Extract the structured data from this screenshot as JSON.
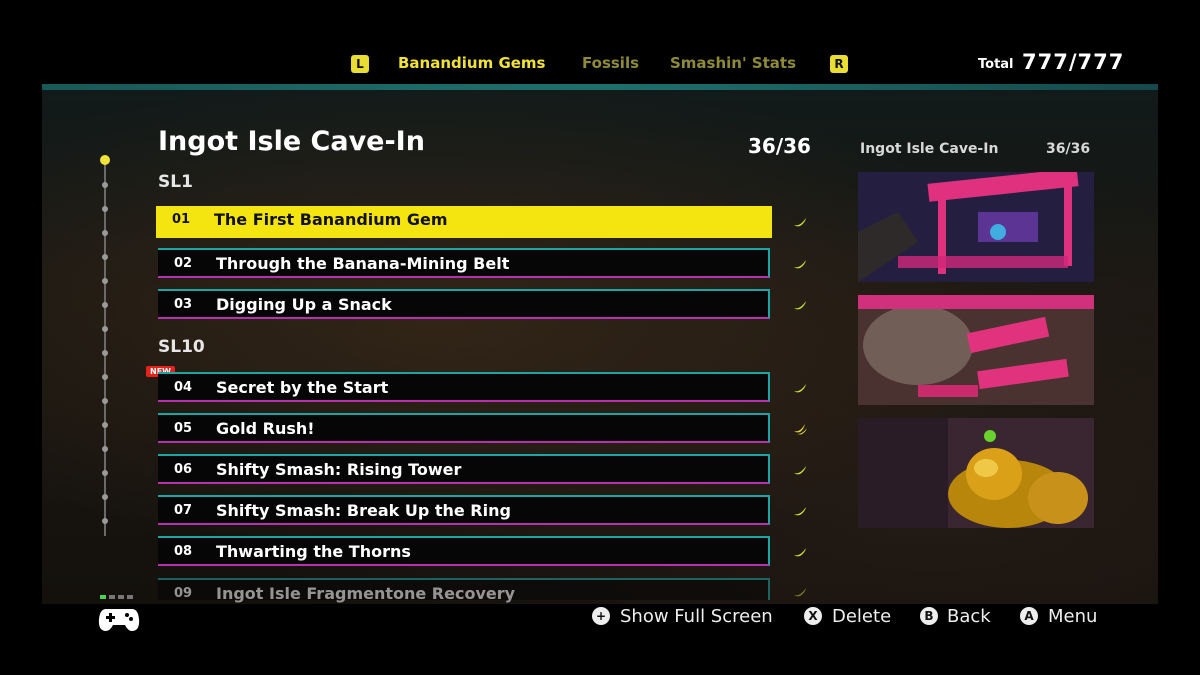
{
  "header": {
    "left_shoulder": "L",
    "right_shoulder": "R",
    "tabs": [
      {
        "label": "Banandium Gems",
        "active": true
      },
      {
        "label": "Fossils",
        "active": false
      },
      {
        "label": "Smashin' Stats",
        "active": false
      }
    ],
    "total_label": "Total",
    "total_value": "777/777"
  },
  "area": {
    "title": "Ingot Isle Cave-In",
    "count": "36/36"
  },
  "sections": [
    {
      "label": "SL1"
    },
    {
      "label": "SL10"
    }
  ],
  "items": [
    {
      "num": "01",
      "name": "The First Banandium Gem",
      "selected": true,
      "icon": "banana-icon"
    },
    {
      "num": "02",
      "name": "Through the Banana-Mining Belt",
      "icon": "banana-icon"
    },
    {
      "num": "03",
      "name": "Digging Up a Snack",
      "icon": "banana-icon"
    },
    {
      "num": "04",
      "name": "Secret by the Start",
      "icon": "banana-icon",
      "badge": "NEW"
    },
    {
      "num": "05",
      "name": "Gold Rush!",
      "icon": "banana-bunch-icon"
    },
    {
      "num": "06",
      "name": "Shifty Smash: Rising Tower",
      "icon": "banana-icon"
    },
    {
      "num": "07",
      "name": "Shifty Smash: Break Up the Ring",
      "icon": "banana-icon"
    },
    {
      "num": "08",
      "name": "Thwarting the Thorns",
      "icon": "banana-icon"
    },
    {
      "num": "09",
      "name": "Ingot Isle Fragmentone Recovery",
      "icon": "banana-icon"
    }
  ],
  "side": {
    "title": "Ingot Isle Cave-In",
    "count": "36/36"
  },
  "footer": {
    "hints": [
      {
        "button": "+",
        "label": "Show Full Screen"
      },
      {
        "button": "X",
        "label": "Delete"
      },
      {
        "button": "B",
        "label": "Back"
      },
      {
        "button": "A",
        "label": "Menu"
      }
    ]
  },
  "colors": {
    "accent": "#f4e40f",
    "border_top": "#1aa6a6",
    "border_bottom": "#b82fb0",
    "banana": "#c8e03a",
    "new_badge": "#e4241b"
  }
}
